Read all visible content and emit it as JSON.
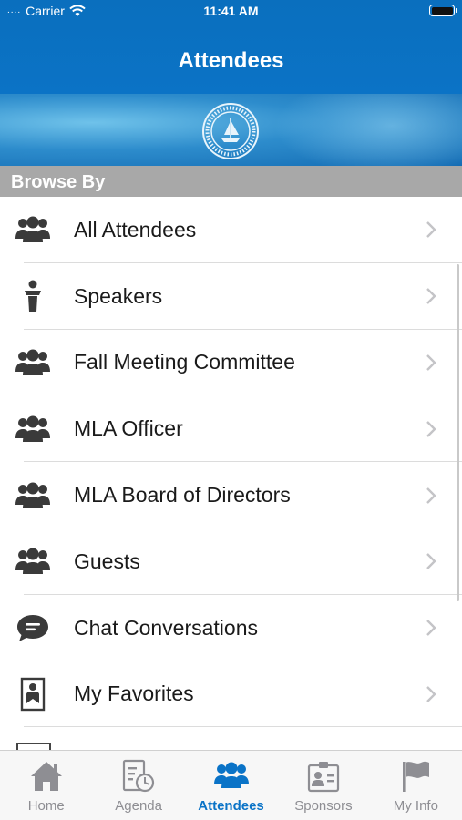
{
  "status_bar": {
    "carrier": "Carrier",
    "time": "11:41 AM",
    "signal": "...."
  },
  "header": {
    "title": "Attendees"
  },
  "browse": {
    "heading": "Browse By",
    "items": [
      {
        "label": "All Attendees",
        "icon": "group-icon"
      },
      {
        "label": "Speakers",
        "icon": "podium-icon"
      },
      {
        "label": "Fall Meeting Committee",
        "icon": "group-icon"
      },
      {
        "label": "MLA Officer",
        "icon": "group-icon"
      },
      {
        "label": "MLA Board of Directors",
        "icon": "group-icon"
      },
      {
        "label": "Guests",
        "icon": "group-icon"
      },
      {
        "label": "Chat Conversations",
        "icon": "chat-bubble-icon"
      },
      {
        "label": "My Favorites",
        "icon": "bookmark-icon"
      }
    ]
  },
  "tabbar": {
    "tabs": [
      {
        "label": "Home",
        "icon": "home-icon",
        "active": false
      },
      {
        "label": "Agenda",
        "icon": "agenda-clock-icon",
        "active": false
      },
      {
        "label": "Attendees",
        "icon": "attendees-icon",
        "active": true
      },
      {
        "label": "Sponsors",
        "icon": "sponsors-badge-icon",
        "active": false
      },
      {
        "label": "My Info",
        "icon": "flag-icon",
        "active": false
      }
    ]
  },
  "colors": {
    "accent": "#0a73c7",
    "header": "#0b73c6",
    "section_header": "#a8a8a8",
    "inactive_tab": "#8e8e93"
  }
}
